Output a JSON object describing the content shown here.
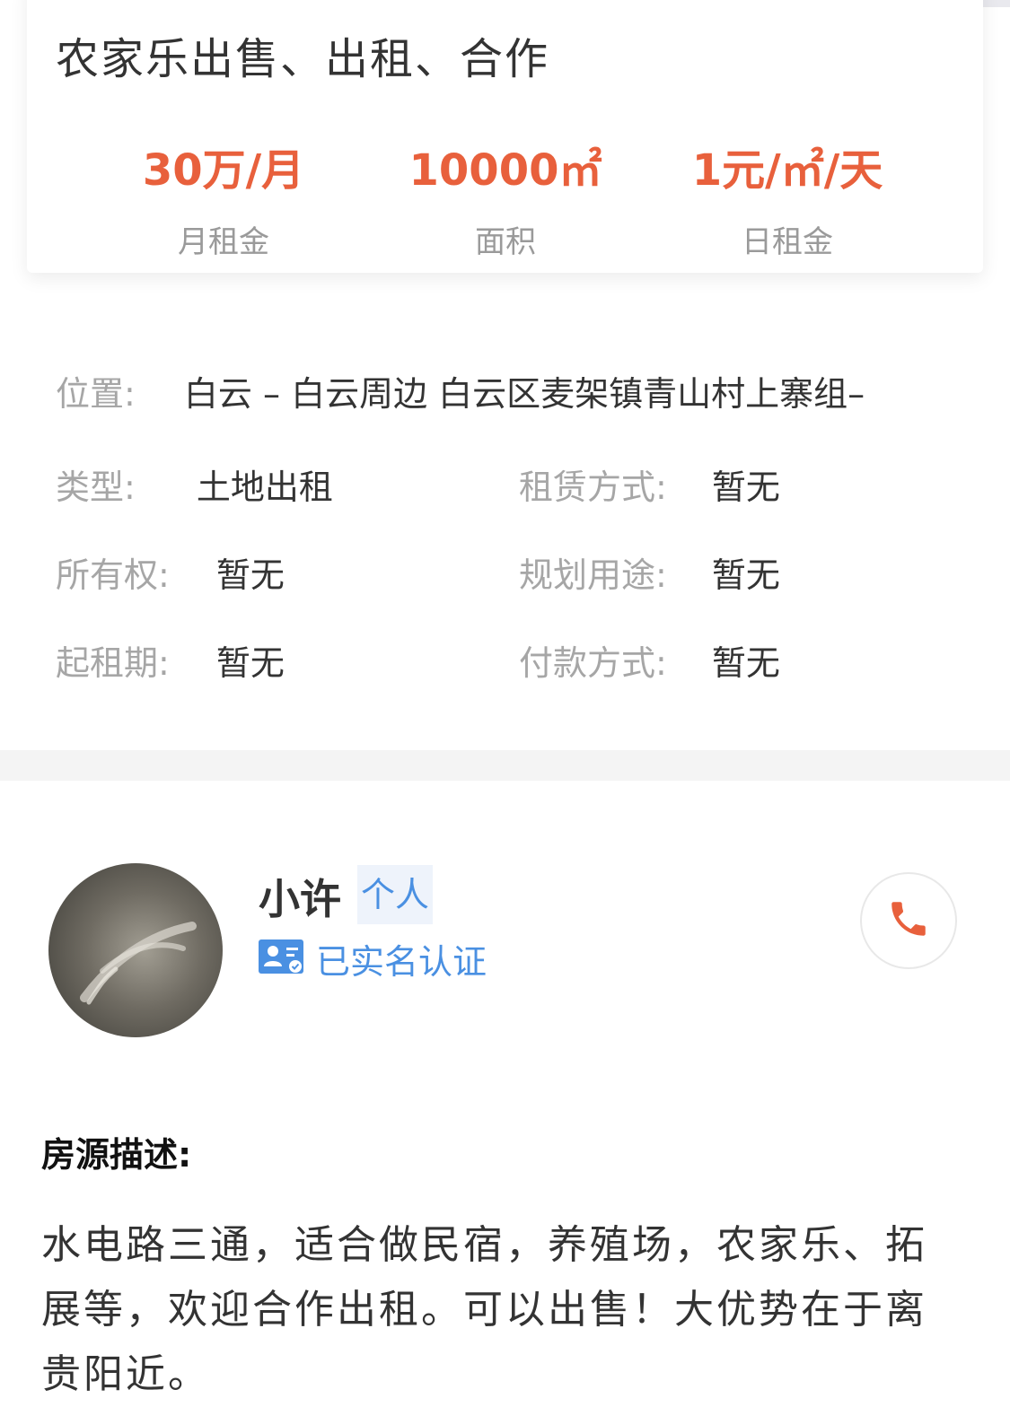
{
  "listing": {
    "title": "农家乐出售、出租、合作",
    "stats": [
      {
        "value": "30万/月",
        "label": "月租金"
      },
      {
        "value": "10000㎡",
        "label": "面积"
      },
      {
        "value": "1元/㎡/天",
        "label": "日租金"
      }
    ]
  },
  "details": {
    "location_label": "位置:",
    "location_value": "白云 – 白云周边 白云区麦架镇青山村上寨组–",
    "type_label": "类型:",
    "type_value": "土地出租",
    "lease_label": "租赁方式:",
    "lease_value": "暂无",
    "ownership_label": "所有权:",
    "ownership_value": "暂无",
    "planning_label": "规划用途:",
    "planning_value": "暂无",
    "start_label": "起租期:",
    "start_value": "暂无",
    "payment_label": "付款方式:",
    "payment_value": "暂无"
  },
  "agent": {
    "name": "小许",
    "tag": "个人",
    "verified_text": "已实名认证",
    "phone_icon": "phone-icon"
  },
  "description": {
    "title": "房源描述:",
    "text": "水电路三通，适合做民宿，养殖场，农家乐、拓展等，欢迎合作出租。可以出售！大优势在于离贵阳近。"
  },
  "colors": {
    "accent": "#e8603c",
    "link": "#4a90e2",
    "muted": "#a6a6a6"
  }
}
